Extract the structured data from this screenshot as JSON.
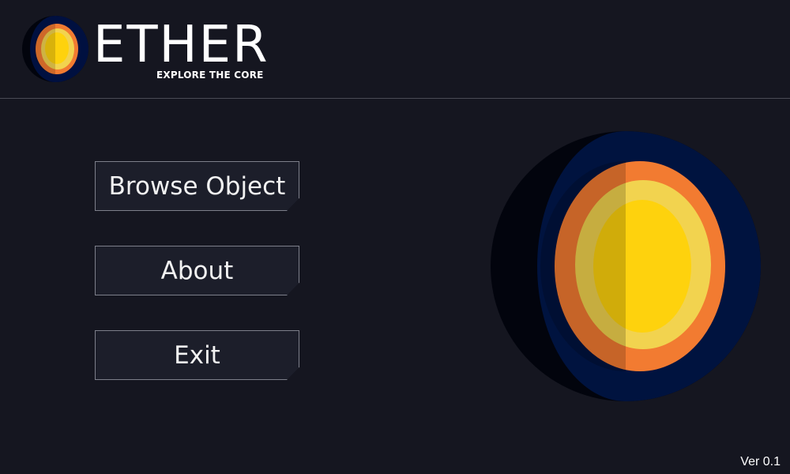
{
  "app": {
    "title": "ETHER",
    "tagline": "EXPLORE THE CORE",
    "version": "Ver 0.1"
  },
  "menu": {
    "browse_label": "Browse Object",
    "about_label": "About",
    "exit_label": "Exit"
  },
  "icons": {
    "logo": "planet-core-logo-icon",
    "illustration": "earth-core-cross-section"
  },
  "colors": {
    "background": "#151620",
    "space": "#02040d",
    "mantle_outer": "#001040",
    "crust_orange": "#f27b31",
    "outer_core": "#f2d34f",
    "inner_core": "#fed20d",
    "button_border": "#7d7f8a"
  }
}
